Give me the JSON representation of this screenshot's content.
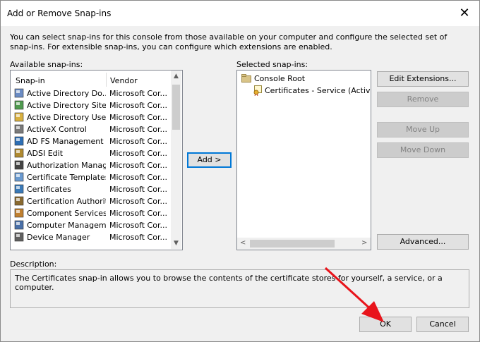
{
  "window": {
    "title": "Add or Remove Snap-ins",
    "close_glyph": "✕"
  },
  "intro_text": "You can select snap-ins for this console from those available on your computer and configure the selected set of snap-ins. For extensible snap-ins, you can configure which extensions are enabled.",
  "available": {
    "label": "Available snap-ins:",
    "col_snapin": "Snap-in",
    "col_vendor": "Vendor",
    "items": [
      {
        "name": "Active Directory Do...",
        "vendor": "Microsoft Cor...",
        "icon": "ad-domains-icon"
      },
      {
        "name": "Active Directory Site...",
        "vendor": "Microsoft Cor...",
        "icon": "ad-sites-icon"
      },
      {
        "name": "Active Directory Use...",
        "vendor": "Microsoft Cor...",
        "icon": "ad-users-icon"
      },
      {
        "name": "ActiveX Control",
        "vendor": "Microsoft Cor...",
        "icon": "activex-icon"
      },
      {
        "name": "AD FS Management",
        "vendor": "Microsoft Cor...",
        "icon": "adfs-icon"
      },
      {
        "name": "ADSI Edit",
        "vendor": "Microsoft Cor...",
        "icon": "adsi-edit-icon"
      },
      {
        "name": "Authorization Manager",
        "vendor": "Microsoft Cor...",
        "icon": "authorization-icon"
      },
      {
        "name": "Certificate Templates",
        "vendor": "Microsoft Cor...",
        "icon": "certificate-templates-icon"
      },
      {
        "name": "Certificates",
        "vendor": "Microsoft Cor...",
        "icon": "certificates-icon"
      },
      {
        "name": "Certification Authority",
        "vendor": "Microsoft Cor...",
        "icon": "certification-authority-icon"
      },
      {
        "name": "Component Services",
        "vendor": "Microsoft Cor...",
        "icon": "component-services-icon"
      },
      {
        "name": "Computer Managem...",
        "vendor": "Microsoft Cor...",
        "icon": "computer-management-icon"
      },
      {
        "name": "Device Manager",
        "vendor": "Microsoft Cor...",
        "icon": "device-manager-icon"
      }
    ]
  },
  "add_button": "Add >",
  "selected": {
    "label": "Selected snap-ins:",
    "root": "Console Root",
    "child": "Certificates - Service (Active Di"
  },
  "buttons": {
    "edit_extensions": "Edit Extensions...",
    "remove": "Remove",
    "move_up": "Move Up",
    "move_down": "Move Down",
    "advanced": "Advanced...",
    "ok": "OK",
    "cancel": "Cancel"
  },
  "description": {
    "label": "Description:",
    "text": "The Certificates snap-in allows you to browse the contents of the certificate stores for yourself, a service, or a computer."
  },
  "colors": {
    "focus_border": "#0078d7",
    "annotation_arrow": "#e8141b"
  }
}
